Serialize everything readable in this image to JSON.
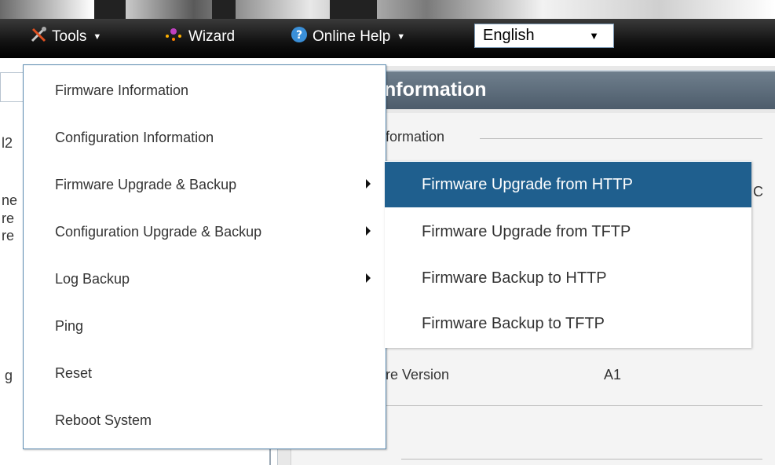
{
  "toolbar": {
    "tools_label": "Tools",
    "wizard_label": "Wizard",
    "help_label": "Online Help",
    "language": "English",
    "icons": {
      "tools": "tools-icon",
      "wizard": "wizard-icon",
      "help": "help-icon"
    }
  },
  "page": {
    "header_title": "nformation",
    "section_title": "formation",
    "row_version": "re Version",
    "row_version_value": "A1",
    "partial_c": "C",
    "left_fragments": [
      "l2",
      "ne",
      "re",
      "re",
      "g"
    ]
  },
  "menu": {
    "items": [
      {
        "label": "Firmware Information",
        "has_sub": false
      },
      {
        "label": "Configuration Information",
        "has_sub": false
      },
      {
        "label": "Firmware Upgrade & Backup",
        "has_sub": true
      },
      {
        "label": "Configuration Upgrade & Backup",
        "has_sub": true
      },
      {
        "label": "Log Backup",
        "has_sub": true
      },
      {
        "label": "Ping",
        "has_sub": false
      },
      {
        "label": "Reset",
        "has_sub": false
      },
      {
        "label": "Reboot System",
        "has_sub": false
      }
    ]
  },
  "submenu": {
    "items": [
      {
        "label": "Firmware Upgrade from HTTP",
        "active": true
      },
      {
        "label": "Firmware Upgrade from TFTP",
        "active": false
      },
      {
        "label": "Firmware Backup to HTTP",
        "active": false
      },
      {
        "label": "Firmware Backup to TFTP",
        "active": false
      }
    ]
  },
  "colors": {
    "accent": "#1f5f8e",
    "toolbar": "#000000",
    "header": "#5a6a7a"
  }
}
